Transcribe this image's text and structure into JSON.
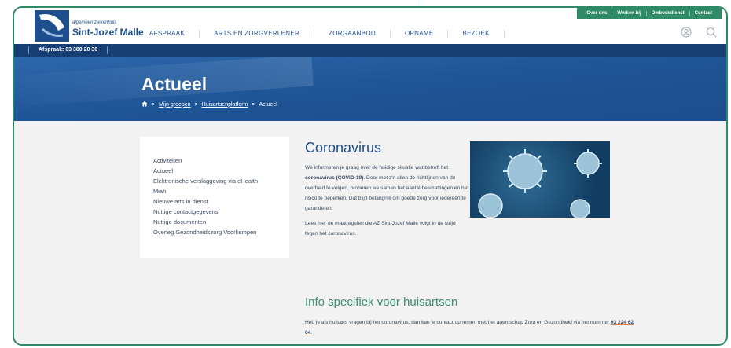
{
  "logo": {
    "small": "algemeen ziekenhuis",
    "name": "Sint-Jozef Malle"
  },
  "nav": [
    "AFSPRAAK",
    "ARTS EN ZORGVERLENER",
    "ZORGAANBOD",
    "OPNAME",
    "BEZOEK"
  ],
  "utility": [
    "Over ons",
    "Werken bij",
    "Ombudsdienst",
    "Contact"
  ],
  "header_icons": [
    "user-icon",
    "search-icon"
  ],
  "infobar": {
    "phone": "Afspraak: 03 380 20 30"
  },
  "page": {
    "title": "Actueel",
    "breadcrumb": [
      "Mijn groepen",
      "Huisartsenplatform",
      "Actueel"
    ]
  },
  "sidemenu": [
    "Activiteiten",
    "Actueel",
    "Elektronische verslaggeving via eHealth",
    "Miah",
    "Nieuwe arts in dienst",
    "Nuttige contactgegevens",
    "Nuttige documenten",
    "Overleg Gezondheidszorg Voorkempen"
  ],
  "article": {
    "title": "Coronavirus",
    "p1_a": "We informeren je graag over de huidige situatie wat betreft het ",
    "p1_bold": "coronavirus (COVID-19)",
    "p1_b": ". Door met z'n allen de richtlijnen van de overheid te volgen, proberen we samen het aantal besmettingen en het risico  te beperken. Dat blijft belangrijk om goede zorg voor iedereen te garanderen.",
    "p2": "Lees hier de maatregelen die AZ Sint-Jozef Malle volgt in de strijd tegen het coronavirus."
  },
  "info": {
    "title": "Info specifiek voor huisartsen",
    "text_a": "Heb je als huisarts vragen bij het coronavirus, dan kan je contact opnemen met het agentschap Zorg en Gezondheid via het nummer ",
    "tel": "03 224 62 04",
    "text_b": "."
  },
  "colors": {
    "brand_blue": "#1f4e8c",
    "brand_green": "#2f8a67",
    "banner_blue": "#1f5697"
  }
}
